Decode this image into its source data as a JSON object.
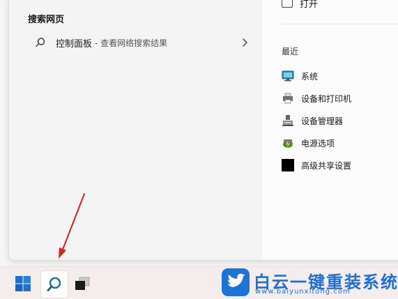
{
  "search": {
    "section_title": "搜索网页",
    "result_main": "控制面板",
    "result_sub": "- 查看网络搜索结果"
  },
  "right_pane": {
    "top_action": "打开",
    "recent_title": "最近",
    "recent_items": [
      {
        "label": "系统",
        "icon": "monitor-icon"
      },
      {
        "label": "设备和打印机",
        "icon": "printer-icon"
      },
      {
        "label": "设备管理器",
        "icon": "device-manager-icon"
      },
      {
        "label": "电源选项",
        "icon": "power-options-icon"
      },
      {
        "label": "高级共享设置",
        "icon": "black-square-icon"
      }
    ]
  },
  "watermark": {
    "title": "白云一键重装系统",
    "url": "www.baiyunxitong.com"
  },
  "colors": {
    "accent_blue": "#1e6fd8",
    "arrow_red": "#e02020",
    "taskbar": "#f5ecec"
  }
}
